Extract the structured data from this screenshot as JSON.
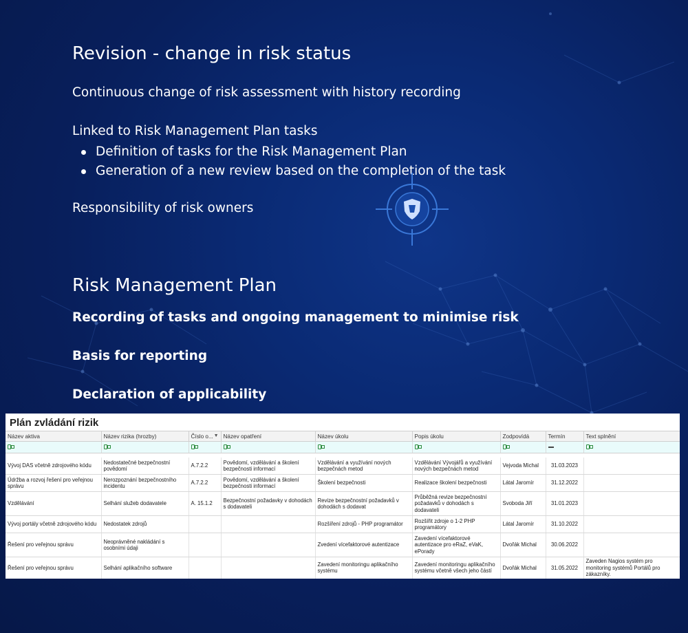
{
  "section1": {
    "title": "Revision - change in risk status",
    "line1": "Continuous change of risk assessment with history recording",
    "line2": "Linked to Risk Management Plan tasks",
    "bullets": [
      "Definition of tasks for the Risk Management Plan",
      "Generation of a new review based on the completion of the task"
    ],
    "line3": "Responsibility of risk owners"
  },
  "section2": {
    "title": "Risk Management Plan",
    "line1": "Recording of tasks and ongoing management to minimise risk",
    "line2": "Basis for reporting",
    "line3": "Declaration of applicability"
  },
  "colors": {
    "background": "#0a2a74",
    "text": "#ffffff",
    "filter_row": "#e9fbfb"
  },
  "icons": [
    "target-shield-icon",
    "filter-icon",
    "sort-icon"
  ],
  "table": {
    "title": "Plán zvládání rizik",
    "columns": [
      "Název aktiva",
      "Název rizika (hrozby)",
      "Číslo o...",
      "Název opatření",
      "Název úkolu",
      "Popis úkolu",
      "Zodpovídá",
      "Termín",
      "Text splnění"
    ],
    "rows": [
      [
        "Vývoj DAS včetně zdrojového kódu",
        "Nedostatečné bezpečnostní povědomí",
        "A.7.2.2",
        "Povědomí, vzdělávání a školení bezpečnosti informací",
        "Vzdělávání a využívání nových bezpečnách metod",
        "Vzdělávání Vývojářů a využívání nových bezpečnách metod",
        "Vejvoda Michal",
        "31.03.2023",
        ""
      ],
      [
        "Údržba a rozvoj řešení pro veřejnou správu",
        "Nerozpoznání bezpečnostního incidentu",
        "A.7.2.2",
        "Povědomí, vzdělávání a školení bezpečnosti informací",
        "Školení bezpečnosti",
        "Realizace školení bezpečnosti",
        "Látal Jaromír",
        "31.12.2022",
        ""
      ],
      [
        "Vzdělávání",
        "Selhání služeb dodavatele",
        "A. 15.1.2",
        "Bezpečnostní požadavky v dohodách s dodavateli",
        "Revize bezpečnostní požadavků v dohodách s dodavat",
        "Průběžná revize bezpečnostní požadavků v dohodách s dodavateli",
        "Svoboda Jiří",
        "31.01.2023",
        ""
      ],
      [
        "Vývoj portály včetně zdrojového kódu",
        "Nedostatek zdrojů",
        "",
        "",
        "Rozšíření zdrojů - PHP programátor",
        "Rozšířit zdroje o 1-2 PHP programátory",
        "Látal Jaromír",
        "31.10.2022",
        ""
      ],
      [
        "Řešení pro veřejnou správu",
        "Neoprávněné nakládání s osobními údaji",
        "",
        "",
        "Zvedení vícefaktorové autentizace",
        "Zavedení vícefaktorové autentizace pro eRaZ, eVaK, ePorady",
        "Dvořák Michal",
        "30.06.2022",
        ""
      ],
      [
        "Řešení pro veřejnou správu",
        "Selhání aplikačního software",
        "",
        "",
        "Zavedení monitoringu aplikačního systému",
        "Zavedení monitoringu aplikačního systému včetně všech jeho částí",
        "Dvořák Michal",
        "31.05.2022",
        "Zaveden Nagios systém pro monitoring systémů Portálů pro zákazníky."
      ]
    ]
  }
}
